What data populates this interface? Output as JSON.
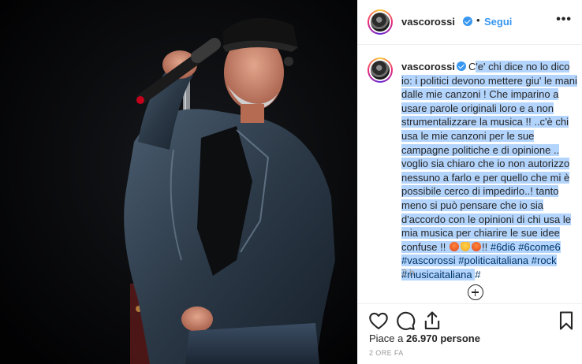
{
  "post": {
    "username": "vascorossi",
    "verified": true,
    "dot": "•",
    "follow_label": "Segui",
    "more_icon": "more-horizontal-icon"
  },
  "caption": {
    "username": "vascorossi",
    "text_before": "C",
    "text_selected": "'e' chi dice no lo dico io: i politici devono mettere giu' le mani dalle mie canzoni ! Che imparino a usare parole originali loro e a non strumentalizzare la musica !! ..c'è chi usa le mie canzoni per le sue campagne politiche e di opinione .. voglio sia chiaro che io non autorizzo nessuno a farlo e per quello che mi è possibile cerco di impedirlo..! tanto meno si può pensare che io sia d'accordo con le opinioni di chi usa le mia musica per chiarire le sue idee confuse !! ",
    "emoji_tail": "!!",
    "hashtags_selected": [
      "#6di6",
      "#6come6"
    ],
    "hashtags": [
      "#vascorossi",
      "#politicaitaliana",
      "#rock",
      "#musicaitaliana"
    ],
    "hashtags_last": "#",
    "emojis": [
      "angry-face",
      "sign-of-horns",
      "angry-face"
    ],
    "time": "2 h",
    "load_more_icon": "plus-circle-icon"
  },
  "actions": {
    "icons": [
      "heart-icon",
      "comment-icon",
      "share-icon",
      "bookmark-icon"
    ],
    "likes_prefix": "Piace a ",
    "likes_count": "26.970",
    "likes_suffix": " persone",
    "time_ago": "2 ORE FA"
  },
  "colors": {
    "accent": "#3897f0",
    "selection": "#b3d4fc",
    "hashtag": "#003569",
    "muted": "#999999"
  }
}
